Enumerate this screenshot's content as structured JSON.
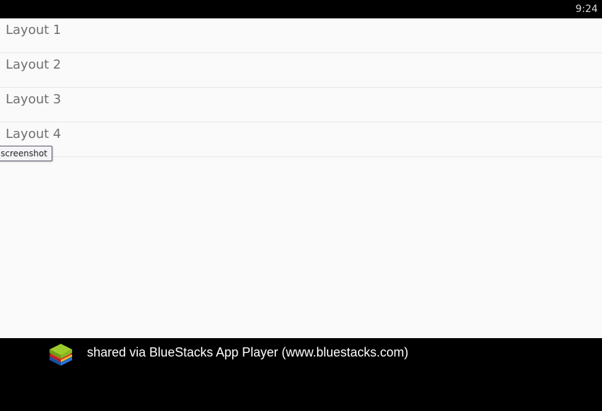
{
  "status_bar": {
    "time": "9:24"
  },
  "list": {
    "items": [
      {
        "label": "Layout 1"
      },
      {
        "label": "Layout 2"
      },
      {
        "label": "Layout 3"
      },
      {
        "label": "Layout 4"
      }
    ]
  },
  "tooltip": {
    "text": "screenshot"
  },
  "footer": {
    "logo_icon": "bluestacks-logo-icon",
    "text": "shared via BlueStacks App Player (www.bluestacks.com)"
  }
}
